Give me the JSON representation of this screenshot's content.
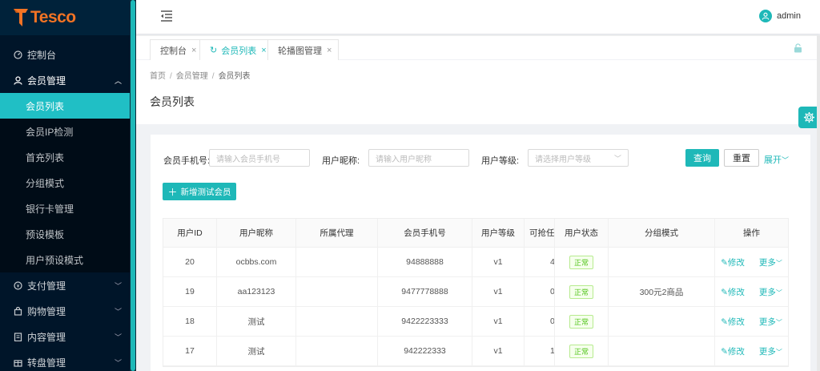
{
  "app": {
    "logo_text": "Tesco",
    "brand_color": "#f27324",
    "accent": "#1eb8b8"
  },
  "sidebar": {
    "items": [
      {
        "label": "控制台",
        "icon": "dashboard-icon"
      },
      {
        "label": "会员管理",
        "icon": "user-icon",
        "open": true,
        "children": [
          "会员列表",
          "会员IP检测",
          "首充列表",
          "分组模式",
          "银行卡管理",
          "预设模板",
          "用户预设模式"
        ],
        "active_child": "会员列表"
      },
      {
        "label": "支付管理",
        "icon": "payment-icon"
      },
      {
        "label": "购物管理",
        "icon": "shopping-icon"
      },
      {
        "label": "内容管理",
        "icon": "content-icon"
      },
      {
        "label": "转盘管理",
        "icon": "wheel-icon"
      }
    ]
  },
  "header": {
    "username": "admin"
  },
  "tabs": [
    {
      "label": "控制台",
      "active": false
    },
    {
      "label": "会员列表",
      "active": true
    },
    {
      "label": "轮播图管理",
      "active": false
    }
  ],
  "breadcrumb": {
    "home": "首页",
    "parent": "会员管理",
    "current": "会员列表"
  },
  "page": {
    "title": "会员列表"
  },
  "filters": {
    "phone_label": "会员手机号:",
    "phone_placeholder": "请输入会员手机号",
    "nick_label": "用户昵称:",
    "nick_placeholder": "请输入用户昵称",
    "level_label": "用户等级:",
    "level_placeholder": "请选择用户等级",
    "query": "查询",
    "reset": "重置",
    "expand": "展开"
  },
  "actions": {
    "add_test_member": "新增测试会员"
  },
  "table": {
    "columns": [
      "用户ID",
      "用户昵称",
      "所属代理",
      "会员手机号",
      "用户等级",
      "可抢任务",
      "用户状态",
      "分组模式",
      "操作"
    ],
    "rows": [
      {
        "id": "20",
        "nick": "ocbbs.com",
        "agent": "",
        "phone": "94888888",
        "level": "v1",
        "tasks": "4",
        "status": "正常",
        "group": "",
        "edit": "修改",
        "more": "更多"
      },
      {
        "id": "19",
        "nick": "aa123123",
        "agent": "",
        "phone": "9477778888",
        "level": "v1",
        "tasks": "0",
        "status": "正常",
        "group": "300元2商品",
        "edit": "修改",
        "more": "更多"
      },
      {
        "id": "18",
        "nick": "测试",
        "agent": "",
        "phone": "9422223333",
        "level": "v1",
        "tasks": "0",
        "status": "正常",
        "group": "",
        "edit": "修改",
        "more": "更多"
      },
      {
        "id": "17",
        "nick": "测试",
        "agent": "",
        "phone": "942222333",
        "level": "v1",
        "tasks": "1",
        "status": "正常",
        "group": "",
        "edit": "修改",
        "more": "更多"
      }
    ]
  }
}
